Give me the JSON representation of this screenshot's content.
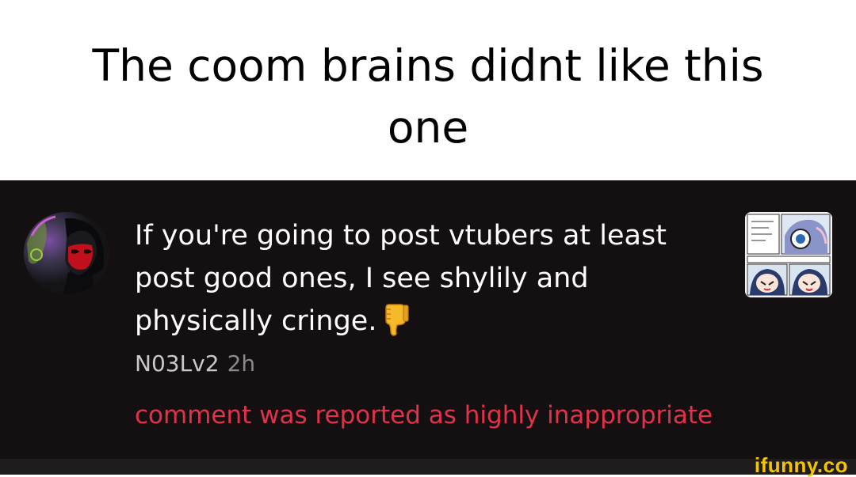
{
  "caption": {
    "text": "The coom brains didnt like this one"
  },
  "comment": {
    "text": "If you're going to post vtubers at least post good ones, I see shylily and physically cringe.",
    "emoji_icon": "thumbs-down-icon",
    "username": "N03Lv2",
    "timestamp": "2h",
    "report_notice": "comment was reported as highly inappropriate"
  },
  "watermark": {
    "text": "ifunny.co"
  },
  "colors": {
    "panel_background": "#140f10",
    "comment_text": "#ffffff",
    "username": "#c9c9c9",
    "timestamp": "#8a8a8a",
    "report_notice": "#e0324a",
    "watermark": "#f5c400"
  }
}
